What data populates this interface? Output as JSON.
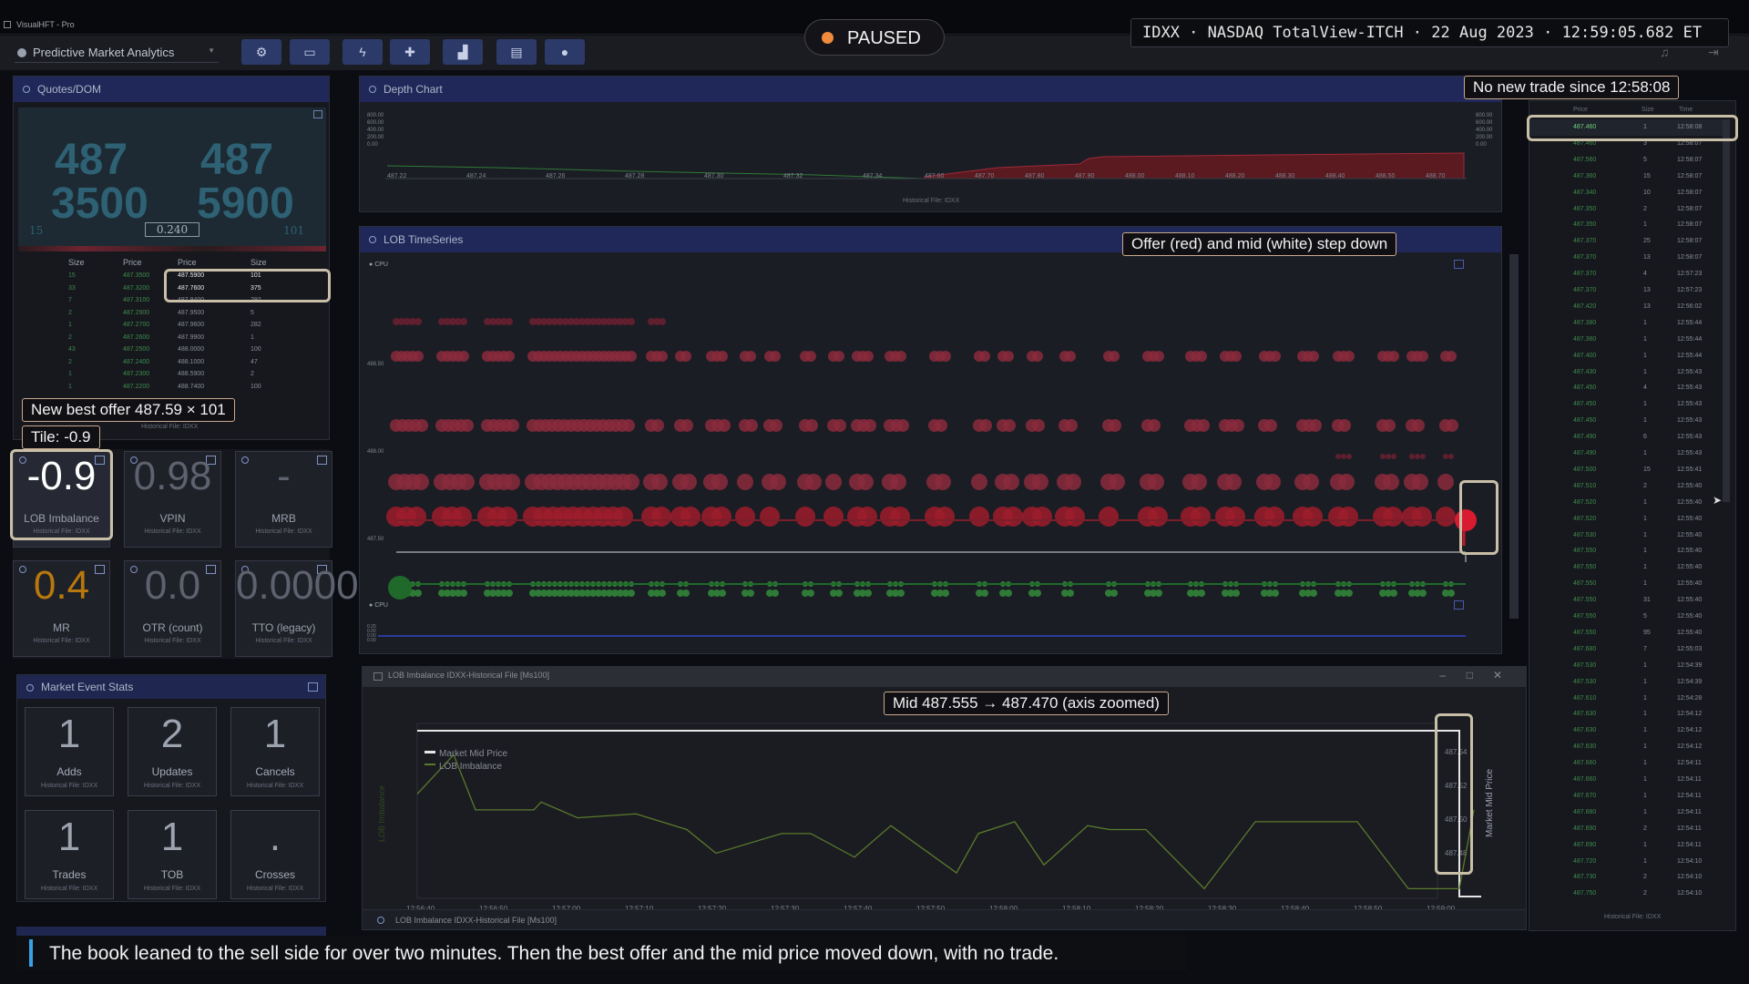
{
  "window": {
    "title": "VisualHFT - Pro"
  },
  "header": {
    "workspace": "Predictive Market Analytics",
    "status": "PAUSED",
    "ticker": "IDXX · NASDAQ TotalView-ITCH · 22 Aug 2023 · 12:59:05.682 ET"
  },
  "toolbar": {
    "icons": [
      "gear-icon",
      "monitor-icon",
      "bolt-icon",
      "puzzle-icon",
      "chart-icon",
      "keyboard-icon",
      "user-icon"
    ]
  },
  "quotes": {
    "title": "Quotes/DOM",
    "bid_price": "487",
    "bid_size": "3500",
    "ask_price": "487",
    "ask_size": "5900",
    "bid_count": "15",
    "spread": "0.240",
    "ask_count": "101",
    "cols": [
      "Size",
      "Price",
      "Price",
      "Size"
    ],
    "rows": [
      [
        "15",
        "487.3500",
        "487.5900",
        "101"
      ],
      [
        "33",
        "487.3200",
        "487.7600",
        "375"
      ],
      [
        "7",
        "487.3100",
        "487.9400",
        "292"
      ],
      [
        "2",
        "487.2900",
        "487.9500",
        "5"
      ],
      [
        "1",
        "487.2700",
        "487.9600",
        "282"
      ],
      [
        "2",
        "487.2600",
        "487.9900",
        "1"
      ],
      [
        "43",
        "487.2500",
        "488.0000",
        "100"
      ],
      [
        "2",
        "487.2400",
        "488.1000",
        "47"
      ],
      [
        "1",
        "487.2300",
        "488.5900",
        "2"
      ],
      [
        "1",
        "487.2200",
        "488.7400",
        "100"
      ]
    ],
    "footer": "Historical File: IDXX"
  },
  "tiles": [
    {
      "value": "-0.9",
      "label": "LOB Imbalance",
      "sub": "Historical File: IDXX",
      "color": "#ffffff"
    },
    {
      "value": "0.98",
      "label": "VPIN",
      "sub": "Historical File: IDXX",
      "color": "#5d626e"
    },
    {
      "value": "-",
      "label": "MRB",
      "sub": "Historical File: IDXX",
      "color": "#5d626e"
    },
    {
      "value": "0.4",
      "label": "MR",
      "sub": "Historical File: IDXX",
      "color": "#b8780c"
    },
    {
      "value": "0.0",
      "label": "OTR (count)",
      "sub": "Historical File: IDXX",
      "color": "#5d626e"
    },
    {
      "value": "0.0000",
      "label": "TTO (legacy)",
      "sub": "Historical File: IDXX",
      "color": "#5d626e"
    }
  ],
  "events": {
    "title": "Market Event Stats",
    "items": [
      {
        "value": "1",
        "label": "Adds",
        "sub": "Historical File: IDXX"
      },
      {
        "value": "2",
        "label": "Updates",
        "sub": "Historical File: IDXX"
      },
      {
        "value": "1",
        "label": "Cancels",
        "sub": "Historical File: IDXX"
      },
      {
        "value": "1",
        "label": "Trades",
        "sub": "Historical File: IDXX"
      },
      {
        "value": "1",
        "label": "TOB",
        "sub": "Historical File: IDXX"
      },
      {
        "value": ".",
        "label": "Crosses",
        "sub": "Historical File: IDXX"
      }
    ]
  },
  "depth": {
    "title": "Depth Chart",
    "bid_ticks": [
      "487.22",
      "487.24",
      "487.26",
      "487.28",
      "487.30",
      "487.32",
      "487.34"
    ],
    "ask_ticks": [
      "487.60",
      "487.70",
      "487.80",
      "487.90",
      "488.00",
      "488.10",
      "488.20",
      "488.30",
      "488.40",
      "488.50",
      "488.70"
    ],
    "y_ticks": [
      "800.00",
      "600.00",
      "400.00",
      "200.00",
      "0.00"
    ],
    "footer": "Historical File: IDXX"
  },
  "lob": {
    "title": "LOB TimeSeries",
    "badge": "CPU",
    "y_labels": [
      "488.50",
      "488.00",
      "487.50"
    ],
    "y2": [
      "0.25",
      "0.00",
      "0.00",
      "0.00"
    ]
  },
  "imb": {
    "title": "LOB Imbalance IDXX-Historical File [Ms100]",
    "footer": "LOB Imbalance IDXX-Historical File [Ms100]",
    "legend": [
      "Market Mid Price",
      "LOB Imbalance"
    ],
    "xlabel": "Timestamp",
    "ylabel": "Market Mid Price",
    "ylabel_left": "LOB Imbalance"
  },
  "chart_data": {
    "type": "line",
    "title": "",
    "xlabel": "Timestamp",
    "ylabel": "Market Mid Price",
    "x": [
      "12:56:40",
      "12:56:50",
      "12:57:00",
      "12:57:10",
      "12:57:20",
      "12:57:30",
      "12:57:40",
      "12:57:50",
      "12:58:00",
      "12:58:10",
      "12:58:20",
      "12:58:30",
      "12:58:40",
      "12:58:50",
      "12:59:00"
    ],
    "ylim": [
      487.47,
      487.555
    ],
    "y_ticks": [
      "487.54",
      "487.52",
      "487.50",
      "487.48"
    ],
    "series": [
      {
        "name": "Market Mid Price",
        "color": "#e6e6e6",
        "values": [
          [
            0,
            487.555
          ],
          [
            14.3,
            487.555
          ],
          [
            14.3,
            487.47
          ],
          [
            14.6,
            487.47
          ]
        ]
      },
      {
        "name": "LOB Imbalance",
        "color": "#5a7a2a",
        "values": [
          [
            0,
            0.3
          ],
          [
            0.5,
            0.8
          ],
          [
            0.8,
            0.1
          ],
          [
            1.6,
            0.1
          ],
          [
            1.7,
            0.2
          ],
          [
            2.2,
            0.0
          ],
          [
            3,
            0.05
          ],
          [
            3.7,
            -0.15
          ],
          [
            4.1,
            -0.45
          ],
          [
            5,
            -0.2
          ],
          [
            5.4,
            -0.2
          ],
          [
            6,
            -0.5
          ],
          [
            6.5,
            -0.1
          ],
          [
            7.4,
            -0.7
          ],
          [
            7.7,
            -0.2
          ],
          [
            8.2,
            -0.05
          ],
          [
            8.6,
            -0.6
          ],
          [
            9.2,
            -0.1
          ],
          [
            9.5,
            -0.15
          ],
          [
            10,
            -0.15
          ],
          [
            10.8,
            -0.9
          ],
          [
            11.5,
            -0.05
          ],
          [
            12.2,
            -0.05
          ],
          [
            12.9,
            -0.05
          ],
          [
            13.6,
            -0.9
          ],
          [
            14.3,
            -0.9
          ],
          [
            14.5,
            0.1
          ]
        ]
      }
    ]
  },
  "trades": {
    "cols": [
      "Price",
      "Size",
      "Time"
    ],
    "footer": "Historical File: IDXX",
    "rows": [
      [
        "487.460",
        "1",
        "12:58:08"
      ],
      [
        "487.460",
        "3",
        "12:58:07"
      ],
      [
        "487.560",
        "5",
        "12:58:07"
      ],
      [
        "487.360",
        "15",
        "12:58:07"
      ],
      [
        "487.340",
        "10",
        "12:58:07"
      ],
      [
        "487.350",
        "2",
        "12:58:07"
      ],
      [
        "487.350",
        "1",
        "12:58:07"
      ],
      [
        "487.370",
        "25",
        "12:58:07"
      ],
      [
        "487.370",
        "13",
        "12:58:07"
      ],
      [
        "487.370",
        "4",
        "12:57:23"
      ],
      [
        "487.370",
        "13",
        "12:57:23"
      ],
      [
        "487.420",
        "13",
        "12:56:02"
      ],
      [
        "487.380",
        "1",
        "12:55:44"
      ],
      [
        "487.380",
        "1",
        "12:55:44"
      ],
      [
        "487.400",
        "1",
        "12:55:44"
      ],
      [
        "487.430",
        "1",
        "12:55:43"
      ],
      [
        "487.450",
        "4",
        "12:55:43"
      ],
      [
        "487.450",
        "1",
        "12:55:43"
      ],
      [
        "487.450",
        "1",
        "12:55:43"
      ],
      [
        "487.490",
        "6",
        "12:55:43"
      ],
      [
        "487.490",
        "1",
        "12:55:43"
      ],
      [
        "487.500",
        "15",
        "12:55:41"
      ],
      [
        "487.510",
        "2",
        "12:55:40"
      ],
      [
        "487.520",
        "1",
        "12:55:40"
      ],
      [
        "487.520",
        "1",
        "12:55:40"
      ],
      [
        "487.530",
        "1",
        "12:55:40"
      ],
      [
        "487.550",
        "1",
        "12:55:40"
      ],
      [
        "487.550",
        "1",
        "12:55:40"
      ],
      [
        "487.550",
        "1",
        "12:55:40"
      ],
      [
        "487.550",
        "31",
        "12:55:40"
      ],
      [
        "487.550",
        "5",
        "12:55:40"
      ],
      [
        "487.550",
        "95",
        "12:55:40"
      ],
      [
        "487.680",
        "7",
        "12:55:03"
      ],
      [
        "487.530",
        "1",
        "12:54:39"
      ],
      [
        "487.530",
        "1",
        "12:54:39"
      ],
      [
        "487.610",
        "1",
        "12:54:28"
      ],
      [
        "487.630",
        "1",
        "12:54:12"
      ],
      [
        "487.630",
        "1",
        "12:54:12"
      ],
      [
        "487.630",
        "1",
        "12:54:12"
      ],
      [
        "487.660",
        "1",
        "12:54:11"
      ],
      [
        "487.660",
        "1",
        "12:54:11"
      ],
      [
        "487.670",
        "1",
        "12:54:11"
      ],
      [
        "487.680",
        "1",
        "12:54:11"
      ],
      [
        "487.690",
        "2",
        "12:54:11"
      ],
      [
        "487.690",
        "1",
        "12:54:11"
      ],
      [
        "487.720",
        "1",
        "12:54:10"
      ],
      [
        "487.730",
        "2",
        "12:54:10"
      ],
      [
        "487.750",
        "2",
        "12:54:10"
      ]
    ]
  },
  "callouts": {
    "trade": "No new trade since 12:58:08",
    "offer": "New best offer 487.59 × 101",
    "tile": "Tile: -0.9",
    "lob": "Offer (red) and mid (white) step down",
    "mid": "Mid 487.555 → 487.470 (axis zoomed)"
  },
  "caption": "The book leaned to the sell side for over two minutes. Then the best offer and the mid price moved down, with no trade.",
  "colors": {
    "ask": "#9e2a3a",
    "bid": "#2e7a36",
    "accent": "#2c3a6a",
    "callout_border": "#c9a98e"
  }
}
